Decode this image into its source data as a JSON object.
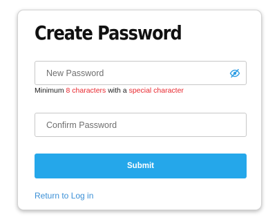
{
  "form": {
    "title": "Create Password",
    "new_password": {
      "placeholder": "New Password",
      "value": "",
      "toggle_icon": "eye-slash-icon"
    },
    "hint": {
      "prefix": "Minimum ",
      "highlight_length": "8 characters",
      "middle": " with a ",
      "highlight_special": "special character"
    },
    "confirm_password": {
      "placeholder": "Confirm Password",
      "value": ""
    },
    "submit_label": "Submit",
    "return_link_label": "Return to Log in"
  },
  "colors": {
    "accent": "#25a7ea",
    "link": "#3a8fd6",
    "hint_highlight": "#e8262d",
    "title": "#111111"
  }
}
